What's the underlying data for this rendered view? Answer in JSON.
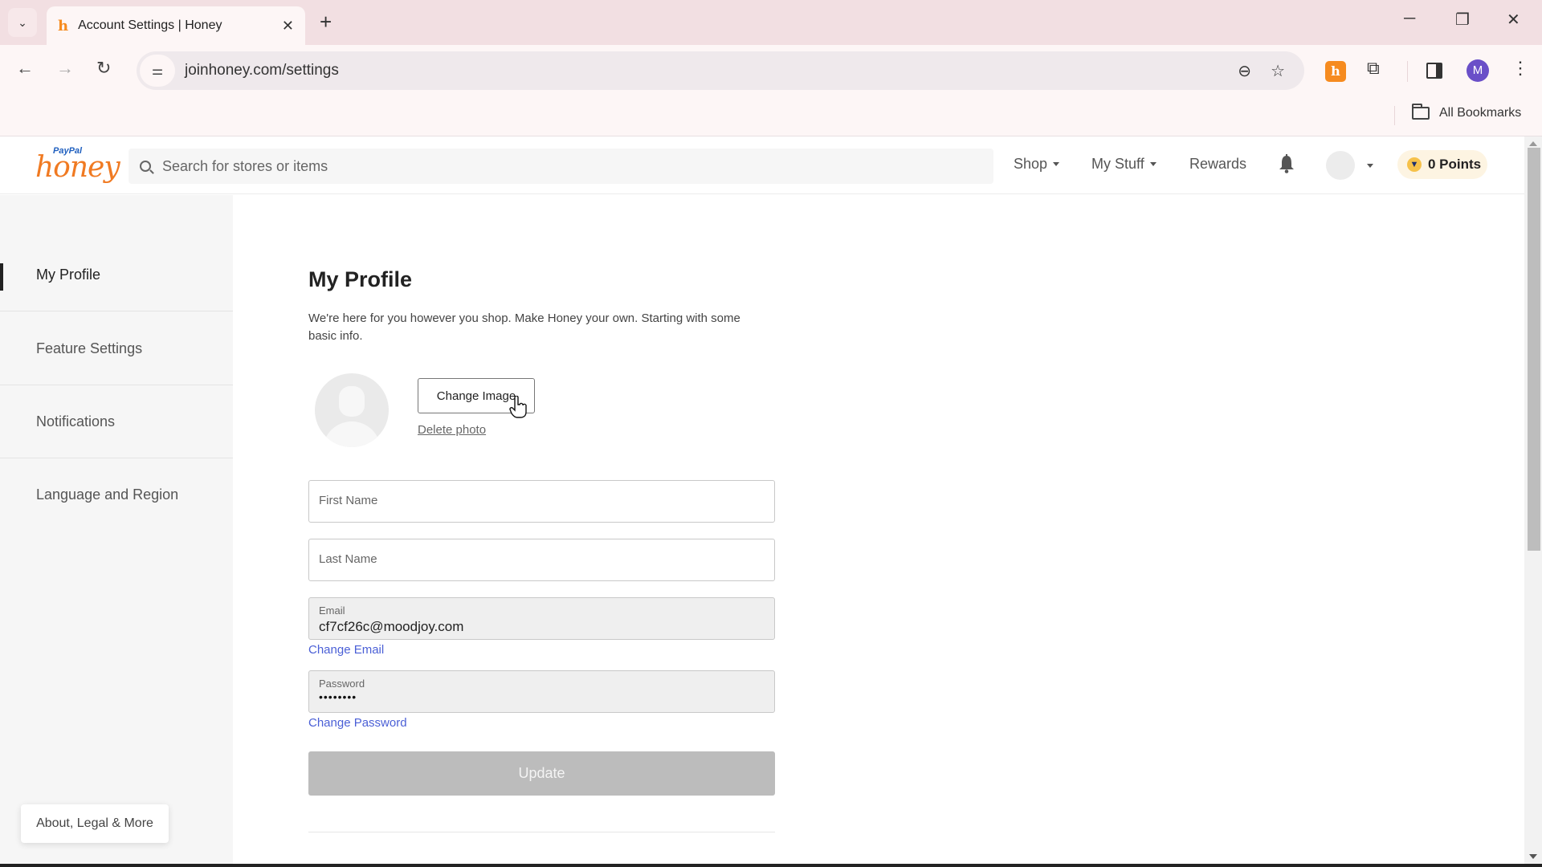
{
  "browser": {
    "tab_title": "Account Settings | Honey",
    "url": "joinhoney.com/settings",
    "bookmarks_label": "All Bookmarks",
    "profile_initial": "M",
    "icons": {
      "tab_search": "chevron-down-icon",
      "favicon": "honey-h-icon",
      "close": "close-icon",
      "new_tab": "plus-icon",
      "back": "arrow-left-icon",
      "forward": "arrow-right-icon",
      "reload": "reload-icon",
      "site_info": "tune-icon",
      "zoom": "zoom-out-icon",
      "bookmark": "star-icon",
      "extensions": "puzzle-icon",
      "side_panel": "side-panel-icon",
      "menu": "kebab-icon",
      "minimize": "minimize-icon",
      "restore": "restore-icon",
      "window_close": "close-icon"
    },
    "glyphs": {
      "tab_search": "⌄",
      "favicon": "ĥ",
      "close": "✕",
      "new_tab": "+",
      "back": "←",
      "forward": "→",
      "reload": "↻",
      "site_info": "⚌",
      "zoom": "⊖",
      "bookmark": "☆",
      "extension_honey": "h",
      "puzzle": "⧉",
      "menu": "⋮",
      "minimize": "─",
      "restore": "❐",
      "window_close": "✕"
    }
  },
  "header": {
    "logo_paypal": "PayPal",
    "logo_honey": "honey",
    "search_placeholder": "Search for stores or items",
    "nav": {
      "shop": "Shop",
      "my_stuff": "My Stuff",
      "rewards": "Rewards"
    },
    "points": "0 Points",
    "trophy_glyph": "🏆"
  },
  "sidebar": {
    "items": [
      {
        "label": "My Profile",
        "active": true
      },
      {
        "label": "Feature Settings",
        "active": false
      },
      {
        "label": "Notifications",
        "active": false
      },
      {
        "label": "Language and Region",
        "active": false
      }
    ],
    "about": "About, Legal & More"
  },
  "profile": {
    "title": "My Profile",
    "intro": "We're here for you however you shop. Make Honey your own. Starting with some basic info.",
    "change_image": "Change Image",
    "delete_photo": "Delete photo",
    "first_name": {
      "placeholder": "First Name",
      "value": ""
    },
    "last_name": {
      "placeholder": "Last Name",
      "value": ""
    },
    "email": {
      "label": "Email",
      "value": "cf7cf26c@moodjoy.com"
    },
    "change_email": "Change Email",
    "password": {
      "label": "Password",
      "value": "••••••••"
    },
    "change_password": "Change Password",
    "update": "Update"
  },
  "colors": {
    "brand_orange": "#f07a22",
    "link_blue": "#4a5fd6",
    "update_disabled": "#bcbcbc",
    "points_bg": "#fdf4e2"
  }
}
